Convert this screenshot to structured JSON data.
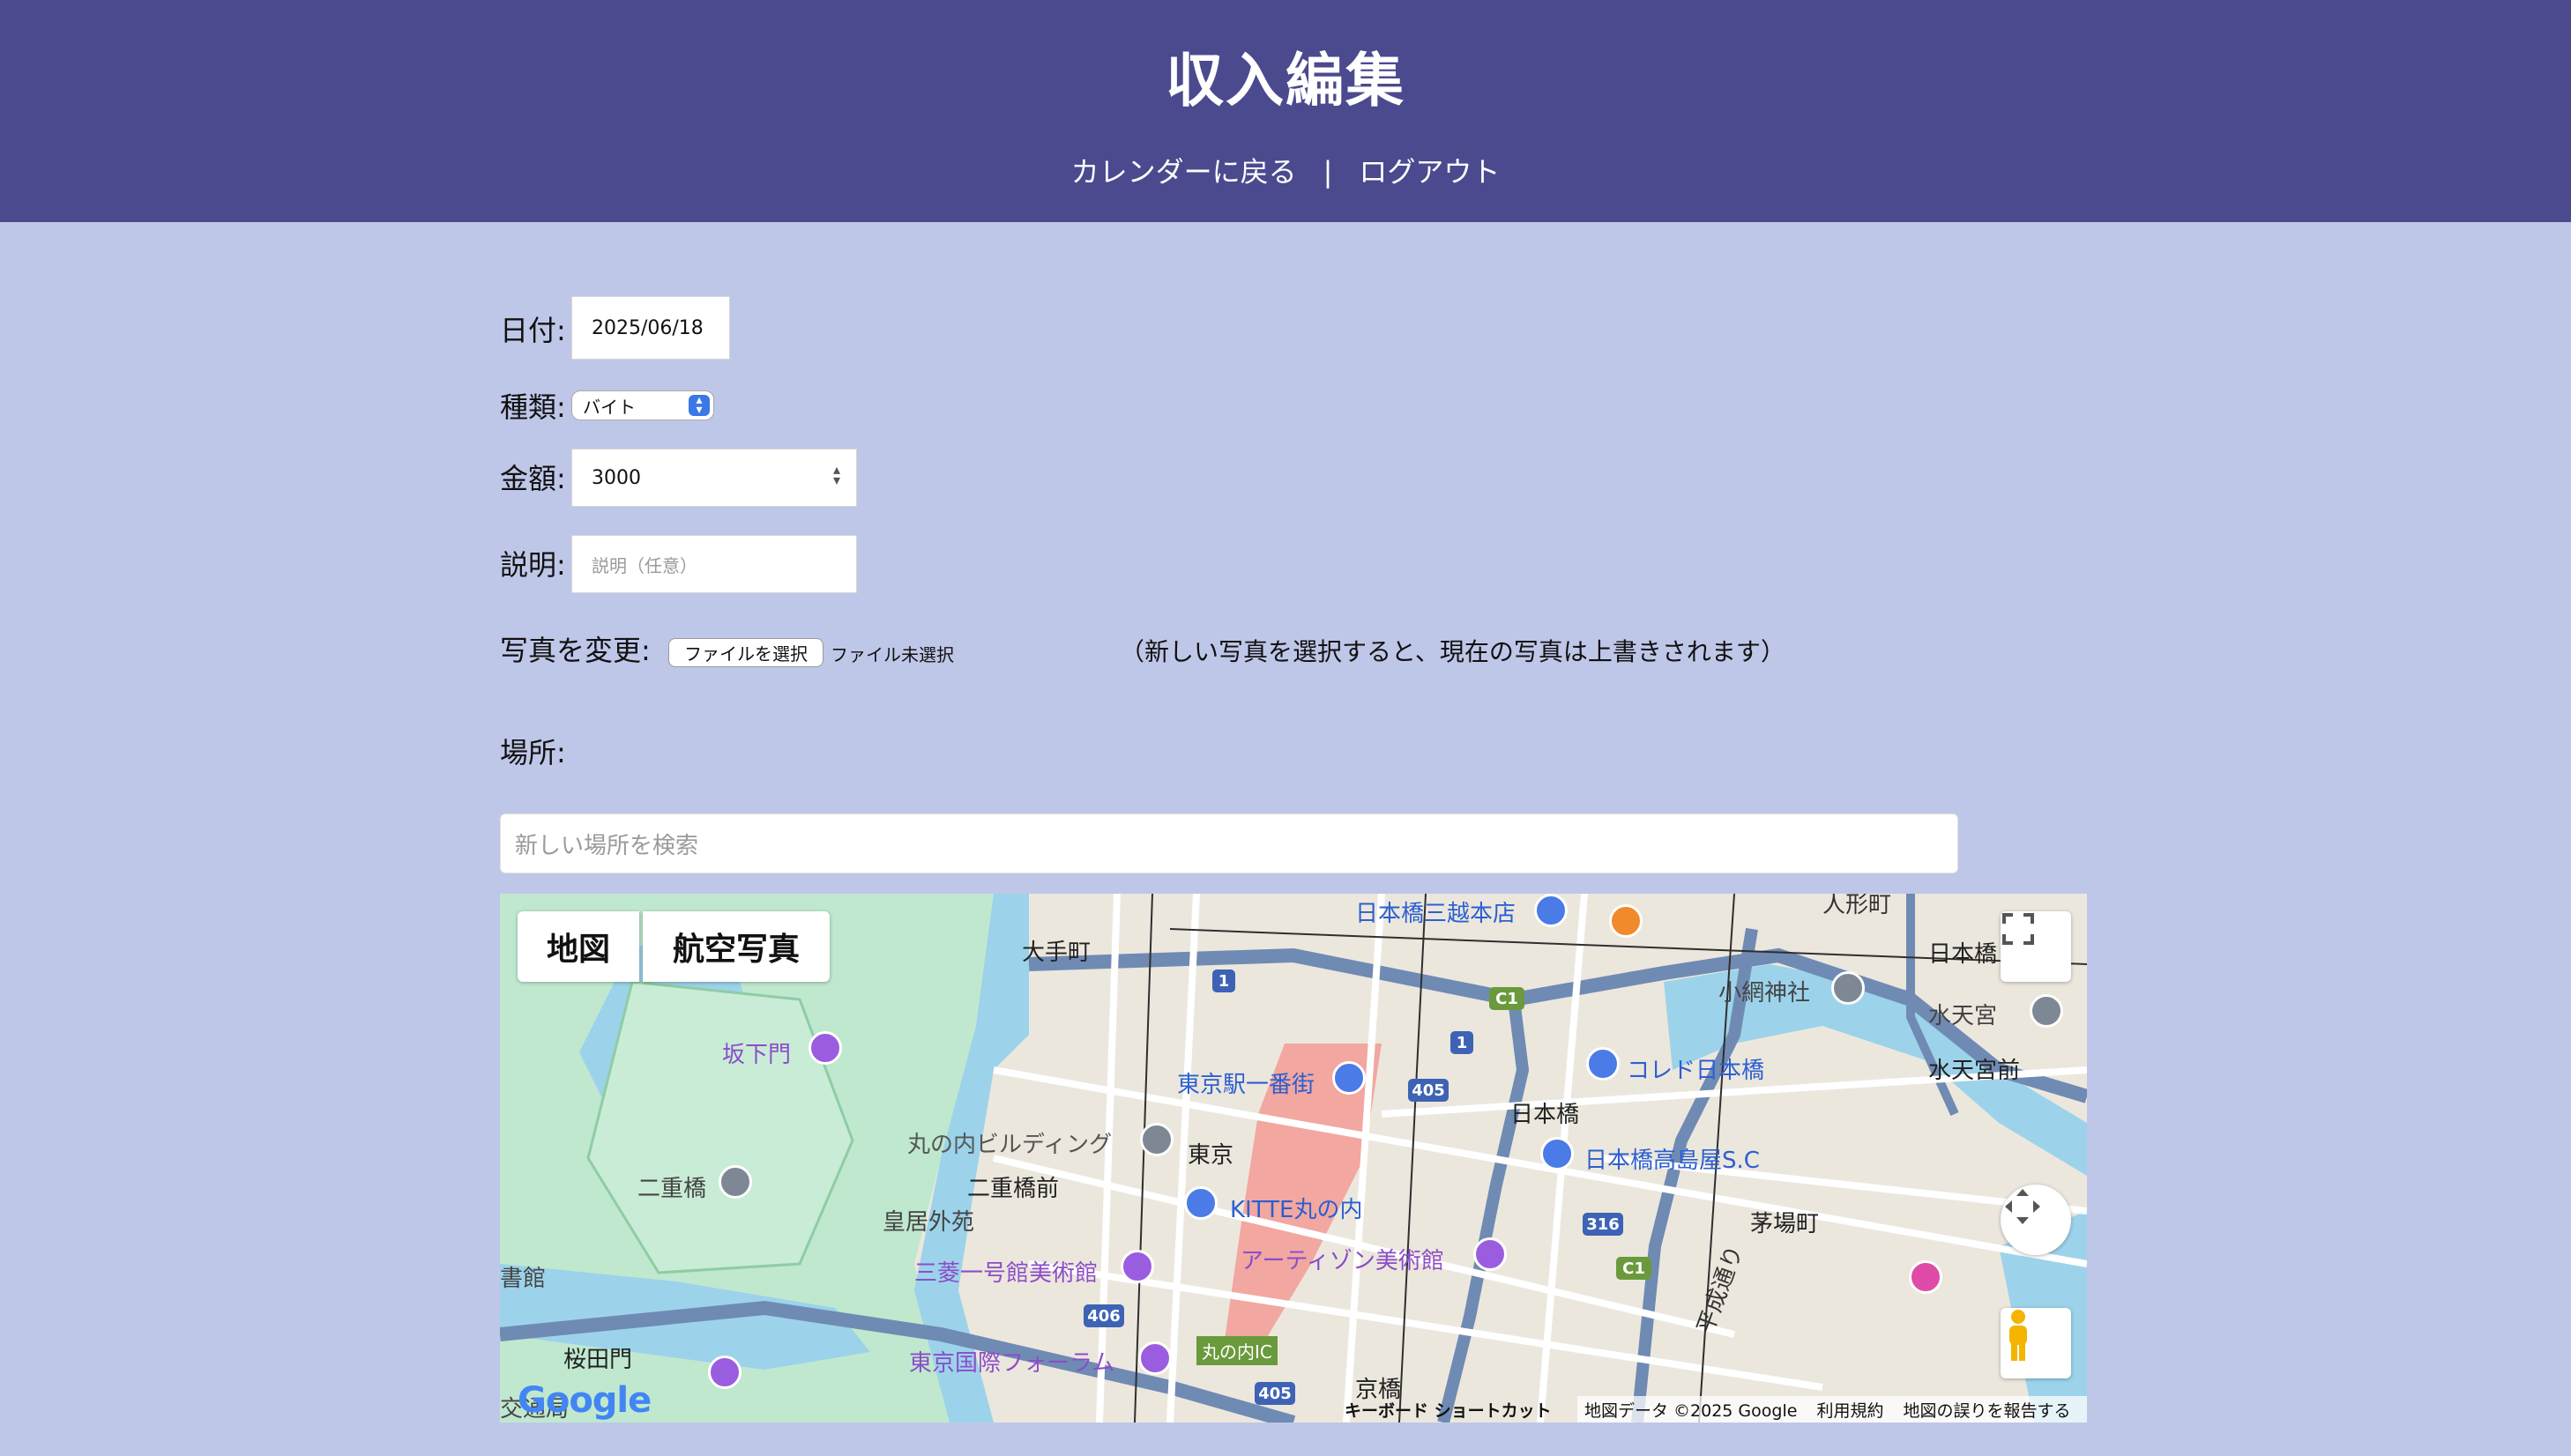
{
  "header": {
    "title": "収入編集",
    "nav_back": "カレンダーに戻る",
    "nav_sep": "|",
    "nav_logout": "ログアウト"
  },
  "form": {
    "date_label": "日付:",
    "date_value": "2025/06/18",
    "type_label": "種類:",
    "type_value": "バイト",
    "amount_label": "金額:",
    "amount_value": "3000",
    "desc_label": "説明:",
    "desc_placeholder": "説明（任意）",
    "photo_label": "写真を変更:",
    "file_button": "ファイルを選択",
    "file_status": "ファイル未選択",
    "photo_note": "（新しい写真を選択すると、現在の写真は上書きされます）",
    "place_label": "場所:",
    "place_search_placeholder": "新しい場所を検索"
  },
  "map": {
    "type_map": "地図",
    "type_satellite": "航空写真",
    "labels": [
      "日本橋三越本店",
      "人形町",
      "大手町",
      "日本橋",
      "小網神社",
      "水天宮",
      "坂下門",
      "東京駅一番街",
      "水天宮前",
      "コレド日本橋",
      "日本橋",
      "丸の内ビルディング",
      "東京",
      "日本橋高島屋S.C",
      "二重橋",
      "二重橋前",
      "KITTE丸の内",
      "皇居外苑",
      "茅場町",
      "アーティゾン美術館",
      "三菱一号館美術館",
      "平成通り",
      "書館",
      "桜田門",
      "東京国際フォーラム",
      "丸の内IC",
      "京橋",
      "交通局"
    ],
    "road_shields": [
      "1",
      "1",
      "C1",
      "405",
      "316",
      "C1",
      "406",
      "405"
    ],
    "footer_shortcuts": "キーボード ショートカット",
    "footer_data": "地図データ ©2025 Google",
    "footer_terms": "利用規約",
    "footer_report": "地図の誤りを報告する",
    "logo": "Google"
  }
}
